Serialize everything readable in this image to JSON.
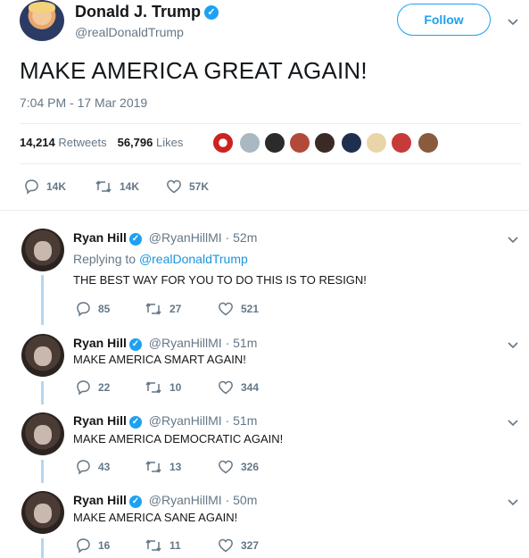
{
  "main_tweet": {
    "author_name": "Donald J. Trump",
    "author_handle": "@realDonaldTrump",
    "follow_label": "Follow",
    "text": "MAKE AMERICA GREAT AGAIN!",
    "timestamp": "7:04 PM - 17 Mar 2019",
    "retweets_count": "14,214",
    "retweets_label": "Retweets",
    "likes_count": "56,796",
    "likes_label": "Likes",
    "actions": {
      "replies": "14K",
      "retweets": "14K",
      "likes": "57K"
    }
  },
  "replies": [
    {
      "name": "Ryan Hill",
      "handle": "@RyanHillMI",
      "time": "· 52m",
      "replying_prefix": "Replying to",
      "replying_to": "@realDonaldTrump",
      "text": "THE BEST WAY FOR YOU TO DO THIS IS TO RESIGN!",
      "replies": "85",
      "retweets": "27",
      "likes": "521"
    },
    {
      "name": "Ryan Hill",
      "handle": "@RyanHillMI",
      "time": "· 51m",
      "text": "MAKE AMERICA SMART AGAIN!",
      "replies": "22",
      "retweets": "10",
      "likes": "344"
    },
    {
      "name": "Ryan Hill",
      "handle": "@RyanHillMI",
      "time": "· 51m",
      "text": "MAKE AMERICA DEMOCRATIC AGAIN!",
      "replies": "43",
      "retweets": "13",
      "likes": "326"
    },
    {
      "name": "Ryan Hill",
      "handle": "@RyanHillMI",
      "time": "· 50m",
      "text": "MAKE AMERICA SANE AGAIN!",
      "replies": "16",
      "retweets": "11",
      "likes": "327"
    }
  ],
  "colors": {
    "accent": "#1da1f2",
    "link": "#1b95e0",
    "secondary_text": "#657786",
    "thread_line": "#b3d7f2"
  }
}
